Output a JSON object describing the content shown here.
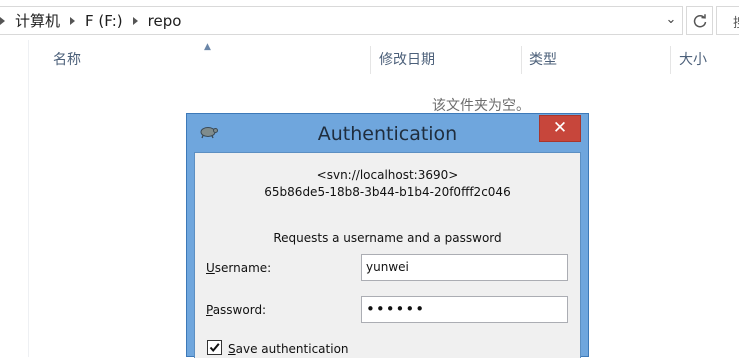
{
  "explorer": {
    "breadcrumb": [
      "计算机",
      "F (F:)",
      "repo"
    ],
    "columns": [
      "名称",
      "修改日期",
      "类型",
      "大小"
    ],
    "empty_message": "该文件夹为空。",
    "search_stub": "搜"
  },
  "dialog": {
    "title": "Authentication",
    "close_label": "✕",
    "realm_line1": "<svn://localhost:3690>",
    "realm_line2": "65b86de5-18b8-3b44-b1b4-20f0fff2c046",
    "prompt": "Requests a username and a password",
    "username_label_u": "U",
    "username_label_rest": "sername:",
    "username_value": "yunwei",
    "password_label_u": "P",
    "password_label_rest": "assword:",
    "password_value": "••••••",
    "save_auth_u": "S",
    "save_auth_rest": "ave authentication",
    "save_auth_checked": true
  }
}
